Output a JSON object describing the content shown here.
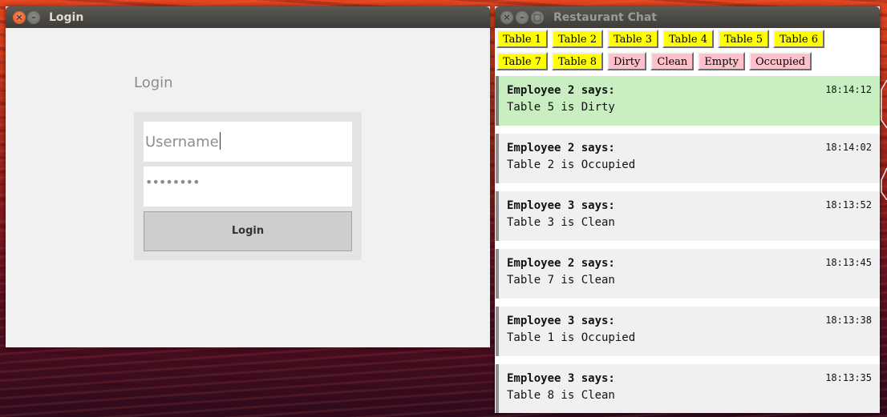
{
  "login_window": {
    "title": "Login",
    "heading": "Login",
    "username_text": "Username",
    "password_mask": "••••••••",
    "login_button": "Login"
  },
  "chat_window": {
    "title": "Restaurant Chat",
    "table_buttons": [
      "Table 1",
      "Table 2",
      "Table 3",
      "Table 4",
      "Table 5",
      "Table 6",
      "Table 7",
      "Table 8"
    ],
    "status_buttons": [
      "Dirty",
      "Clean",
      "Empty",
      "Occupied"
    ],
    "messages": [
      {
        "sender": "Employee 2 says:",
        "text": "Table 5 is Dirty",
        "time": "18:14:12"
      },
      {
        "sender": "Employee 2 says:",
        "text": "Table 2 is Occupied",
        "time": "18:14:02"
      },
      {
        "sender": "Employee 3 says:",
        "text": "Table 3 is Clean",
        "time": "18:13:52"
      },
      {
        "sender": "Employee 2 says:",
        "text": "Table 7 is Clean",
        "time": "18:13:45"
      },
      {
        "sender": "Employee 3 says:",
        "text": "Table 1 is Occupied",
        "time": "18:13:38"
      },
      {
        "sender": "Employee 3 says:",
        "text": "Table 8 is Clean",
        "time": "18:13:35"
      }
    ]
  },
  "colors": {
    "table_button": "#ffff00",
    "status_button": "#ffc0cb",
    "latest_message": "#c8eec2",
    "message": "#f0f0f0",
    "titlebar": "#3c3b37"
  },
  "icons": [
    "close-icon",
    "minimize-icon",
    "maximize-icon"
  ]
}
